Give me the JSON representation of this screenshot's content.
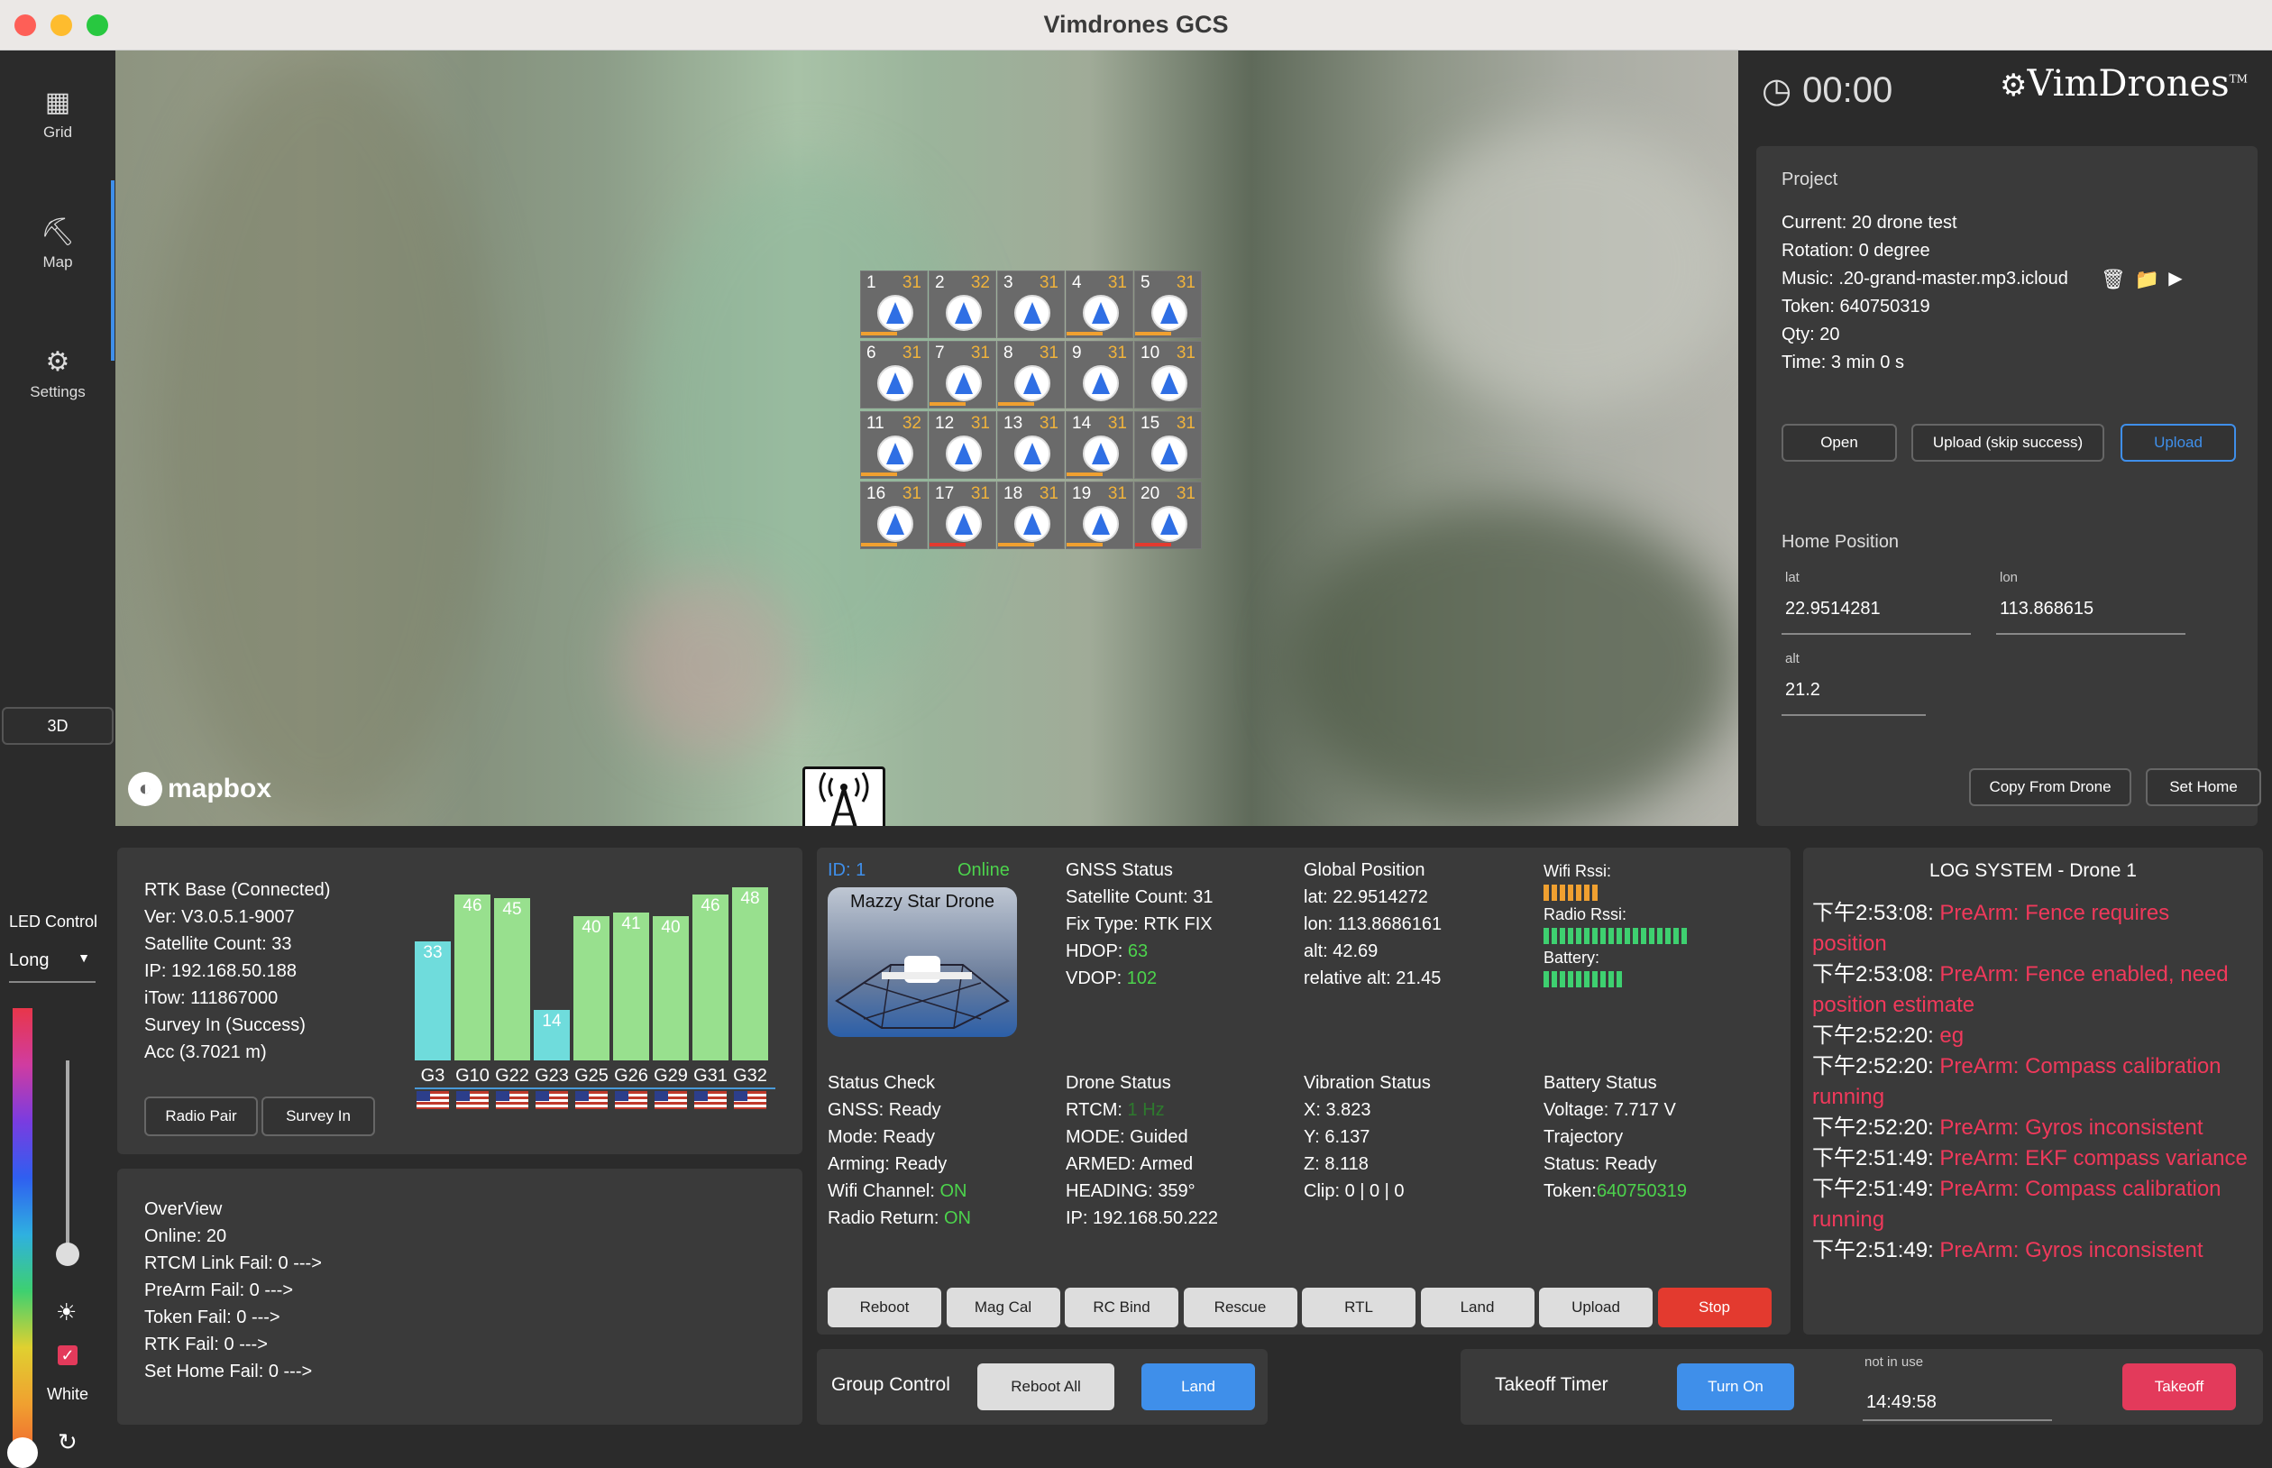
{
  "window": {
    "title": "Vimdrones GCS"
  },
  "sidebar": {
    "items": [
      {
        "label": "Grid",
        "icon": "grid-icon"
      },
      {
        "label": "Map",
        "icon": "map-icon"
      },
      {
        "label": "Settings",
        "icon": "gear-icon"
      }
    ],
    "btn_3d": "3D",
    "active": "Map"
  },
  "led": {
    "title": "LED Control",
    "mode": "Long",
    "color_label": "White",
    "checked": true
  },
  "map": {
    "attribution": "mapbox",
    "drones": [
      {
        "n": "1",
        "s": "31"
      },
      {
        "n": "2",
        "s": "32"
      },
      {
        "n": "3",
        "s": "31"
      },
      {
        "n": "4",
        "s": "31"
      },
      {
        "n": "5",
        "s": "31"
      },
      {
        "n": "6",
        "s": "31"
      },
      {
        "n": "7",
        "s": "31"
      },
      {
        "n": "8",
        "s": "31"
      },
      {
        "n": "9",
        "s": "31"
      },
      {
        "n": "10",
        "s": "31"
      },
      {
        "n": "11",
        "s": "32"
      },
      {
        "n": "12",
        "s": "31"
      },
      {
        "n": "13",
        "s": "31"
      },
      {
        "n": "14",
        "s": "31"
      },
      {
        "n": "15",
        "s": "31"
      },
      {
        "n": "16",
        "s": "31"
      },
      {
        "n": "17",
        "s": "31"
      },
      {
        "n": "18",
        "s": "31"
      },
      {
        "n": "19",
        "s": "31"
      },
      {
        "n": "20",
        "s": "31"
      }
    ]
  },
  "timer": {
    "value": "00:00"
  },
  "brand": {
    "name": "VimDrones",
    "tm": "TM"
  },
  "project": {
    "title": "Project",
    "current": "Current: 20 drone test",
    "rotation": "Rotation: 0 degree",
    "music": "Music: .20-grand-master.mp3.icloud",
    "token": "Token: 640750319",
    "qty": "Qty: 20",
    "time": "Time: 3 min 0 s",
    "open": "Open",
    "upload_skip": "Upload (skip success)",
    "upload": "Upload"
  },
  "home": {
    "title": "Home Position",
    "lat_label": "lat",
    "lat": "22.9514281",
    "lon_label": "lon",
    "lon": "113.868615",
    "alt_label": "alt",
    "alt": "21.2",
    "copy": "Copy From Drone",
    "set": "Set Home"
  },
  "rtk": {
    "lines": [
      "RTK Base (Connected)",
      "Ver: V3.0.5.1-9007",
      "Satellite Count: 33",
      "IP: 192.168.50.188",
      "iTow: 111867000",
      "Survey In (Success)",
      "Acc (3.7021 m)"
    ],
    "radio_pair": "Radio Pair",
    "survey_in": "Survey In",
    "sats": [
      {
        "id": "G3",
        "v": 33
      },
      {
        "id": "G10",
        "v": 46
      },
      {
        "id": "G22",
        "v": 45
      },
      {
        "id": "G23",
        "v": 14
      },
      {
        "id": "G25",
        "v": 40
      },
      {
        "id": "G26",
        "v": 41
      },
      {
        "id": "G29",
        "v": 40
      },
      {
        "id": "G31",
        "v": 46
      },
      {
        "id": "G32",
        "v": 48
      }
    ]
  },
  "overview": {
    "lines": [
      "OverView",
      "Online: 20",
      "RTCM Link Fail: 0 --->",
      "PreArm Fail: 0 --->",
      "Token Fail: 0 --->",
      "RTK Fail: 0 --->",
      "Set Home Fail: 0 --->"
    ]
  },
  "drone": {
    "id": "ID: 1",
    "online": "Online",
    "name": "Mazzy Star Drone",
    "gnss": {
      "title": "GNSS Status",
      "sat": "Satellite Count: 31",
      "fix": "Fix Type: RTK FIX",
      "hdop_l": "HDOP: ",
      "hdop": "63",
      "vdop_l": "VDOP: ",
      "vdop": "102"
    },
    "global": {
      "title": "Global Position",
      "lat": "lat: 22.9514272",
      "lon": "lon: 113.8686161",
      "alt": "alt: 42.69",
      "ralt": "relative alt: 21.45"
    },
    "rssi": {
      "wifi": "Wifi Rssi:",
      "radio": "Radio Rssi:",
      "battery": "Battery:",
      "wifi_level": 0.28,
      "radio_level": 0.9,
      "battery_level": 0.5
    },
    "check": {
      "title": "Status Check",
      "gnss": "GNSS: Ready",
      "mode": "Mode: Ready",
      "arming": "Arming: Ready",
      "wifi_l": "Wifi Channel: ",
      "wifi": "ON",
      "radio_l": "Radio Return: ",
      "radio": "ON"
    },
    "status": {
      "title": "Drone Status",
      "rtcm_l": "RTCM: ",
      "rtcm": "1 Hz",
      "mode": "MODE: Guided",
      "armed": "ARMED: Armed",
      "heading": "HEADING: 359°",
      "ip": "IP: 192.168.50.222"
    },
    "vib": {
      "title": "Vibration Status",
      "x": "X: 3.823",
      "y": "Y: 6.137",
      "z": "Z: 8.118",
      "clip": "Clip: 0 | 0 | 0"
    },
    "battery": {
      "title": "Battery Status",
      "voltage": "Voltage: 7.717 V",
      "traj": "Trajectory",
      "status": "Status: Ready",
      "token_l": "Token:",
      "token": "640750319"
    },
    "buttons": [
      "Reboot",
      "Mag Cal",
      "RC Bind",
      "Rescue",
      "RTL",
      "Land",
      "Upload",
      "Stop"
    ]
  },
  "log": {
    "title": "LOG SYSTEM - Drone 1",
    "entries": [
      {
        "t": "下午2:53:08: ",
        "m": "PreArm: Fence requires",
        "m2": "position"
      },
      {
        "t": "下午2:53:08: ",
        "m": "PreArm: Fence enabled, need",
        "m2": "position estimate"
      },
      {
        "t": "下午2:52:20: ",
        "m": "eg",
        "m2": ""
      },
      {
        "t": "下午2:52:20: ",
        "m": "PreArm: Compass calibration",
        "m2": "running"
      },
      {
        "t": "下午2:52:20: ",
        "m": "PreArm: Gyros inconsistent",
        "m2": ""
      },
      {
        "t": "下午2:51:49: ",
        "m": "PreArm: EKF compass variance",
        "m2": ""
      },
      {
        "t": "下午2:51:49: ",
        "m": "PreArm: Compass calibration",
        "m2": "running"
      },
      {
        "t": "下午2:51:49: ",
        "m": "PreArm: Gyros inconsistent",
        "m2": ""
      }
    ]
  },
  "group": {
    "title": "Group Control",
    "reboot_all": "Reboot All",
    "land": "Land"
  },
  "takeoff": {
    "title": "Takeoff Timer",
    "turn_on": "Turn On",
    "hint": "not in use",
    "time": "14:49:58",
    "takeoff": "Takeoff"
  },
  "colors": {
    "accent_blue": "#3f8fea",
    "stop_red": "#e33a2f",
    "takeoff_red": "#e33a5b",
    "ok_green": "#4cd34c",
    "sat_orange": "#f0b33c"
  }
}
